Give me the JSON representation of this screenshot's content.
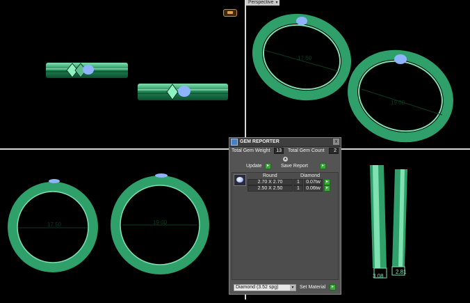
{
  "viewports": {
    "perspective_label": "Perspective",
    "bottom_left": {
      "dim_small": "17.50",
      "dim_large": "19.00"
    },
    "top_right": {
      "dim_small": "17.50",
      "dim_large": "19.00"
    },
    "bottom_right": {
      "dim_left": "3.08",
      "dim_right": "2.81"
    }
  },
  "gem_reporter": {
    "title": "GEM REPORTER",
    "close": "x",
    "total_gem_weight_label": "Total Gem Weight",
    "total_gem_weight_value": "13",
    "total_gem_count_label": "Total Gem Count",
    "total_gem_count_value": "2",
    "update_label": "Update",
    "save_report_label": "Save Report",
    "columns": {
      "shape": "Round",
      "material": "Diamond"
    },
    "rows": [
      {
        "size": "2.70 X 2.70",
        "count": "1",
        "weight": "0.07tw"
      },
      {
        "size": "2.50 X 2.50",
        "count": "1",
        "weight": "0.06tw"
      }
    ],
    "material_select": "Diamond   (3.52 spg)",
    "set_material_label": "Set Material"
  },
  "colors": {
    "ring_green": "#2fa06a",
    "gem_blue": "#8fb4ff",
    "panel_bg": "#545454"
  }
}
